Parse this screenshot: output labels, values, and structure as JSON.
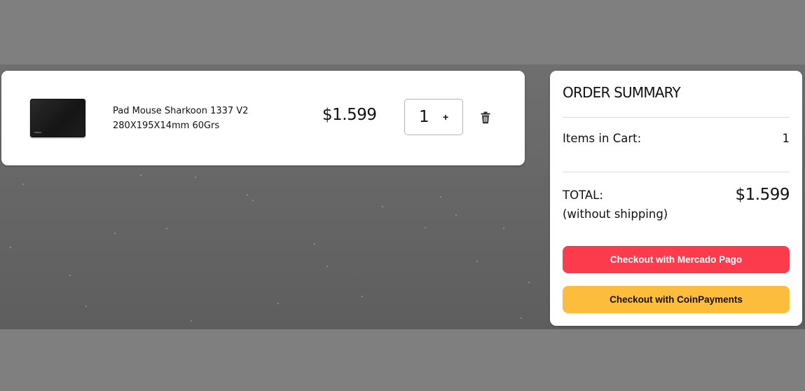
{
  "cart": {
    "items": [
      {
        "name": "Pad Mouse Sharkoon 1337 V2 280X195X14mm 60Grs",
        "price": "$1.599",
        "quantity": "1",
        "increment_label": "+",
        "image_icon": "mousepad-product-image",
        "delete_icon": "trash-icon"
      }
    ]
  },
  "summary": {
    "title": "ORDER SUMMARY",
    "items_label": "Items in Cart:",
    "items_count": "1",
    "total_label": "TOTAL:",
    "total_note": "(without shipping)",
    "total_value": "$1.599",
    "buttons": {
      "mercado_pago": "Checkout with Mercado Pago",
      "coinpayments": "Checkout with CoinPayments"
    }
  },
  "colors": {
    "mercado_pago_button": "#fc3c4c",
    "coinpayments_button": "#fcbc3c",
    "page_background": "#7f7f7f",
    "card_background": "#ffffff"
  }
}
